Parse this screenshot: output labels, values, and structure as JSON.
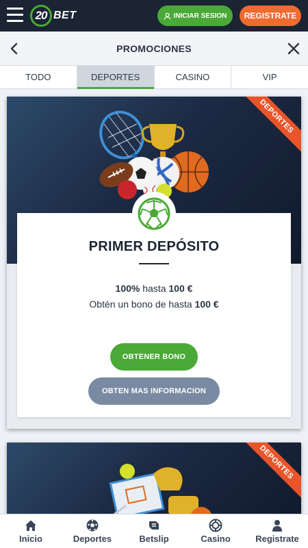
{
  "header": {
    "logo_number": "20",
    "logo_text": "BET",
    "login_label": "INICIAR SESION",
    "register_label": "REGISTRATE"
  },
  "subheader": {
    "title": "PROMOCIONES"
  },
  "tabs": [
    {
      "label": "TODO",
      "active": false
    },
    {
      "label": "DEPORTES",
      "active": true
    },
    {
      "label": "CASINO",
      "active": false
    },
    {
      "label": "VIP",
      "active": false
    }
  ],
  "promos": [
    {
      "ribbon": "DEPORTES",
      "title": "PRIMER DEPÓSITO",
      "line1_bold": "100%",
      "line1_text": " hasta ",
      "line1_amount": "100 €",
      "line2_text": "Obtén un bono de hasta ",
      "line2_amount": "100 €",
      "primary_button": "OBTENER BONO",
      "secondary_button": "OBTEN MAS INFORMACION"
    },
    {
      "ribbon": "DEPORTES"
    }
  ],
  "bottom_nav": [
    {
      "label": "Inicio",
      "icon": "home-icon"
    },
    {
      "label": "Deportes",
      "icon": "soccer-ball-icon"
    },
    {
      "label": "Betslip",
      "icon": "betslip-icon"
    },
    {
      "label": "Casino",
      "icon": "casino-chip-icon"
    },
    {
      "label": "Registrate",
      "icon": "user-icon"
    }
  ],
  "colors": {
    "topbar": "#1b2433",
    "green": "#4aa937",
    "orange": "#f06b30",
    "ribbon": "#e9552a",
    "info_button": "#7a8aa3"
  }
}
